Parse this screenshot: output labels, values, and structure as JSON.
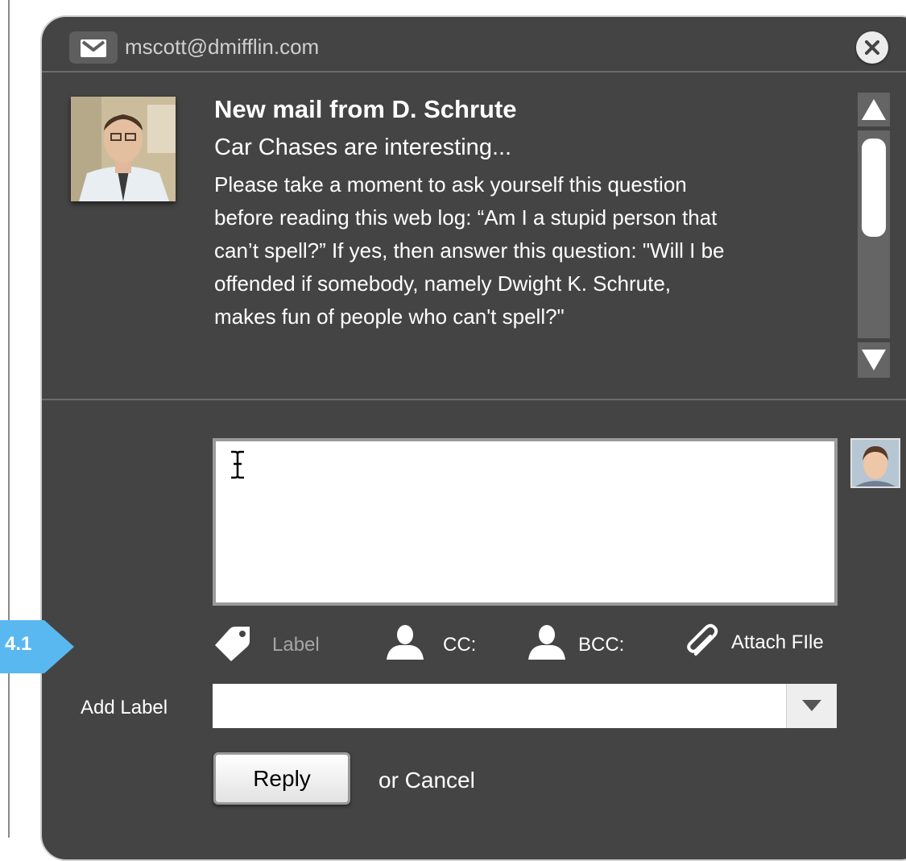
{
  "header": {
    "mail_icon": "envelope-icon",
    "email": "mscott@dmifflin.com",
    "close_icon": "close-icon"
  },
  "message": {
    "title": "New mail from D. Schrute",
    "subject": "Car Chases are interesting...",
    "body_lines": [
      "Please take a moment to ask yourself this question",
      "before reading this web log: “Am I a stupid person that",
      "can’t spell?” If yes, then answer this question: \"Will I be",
      "offended if somebody, namely Dwight K. Schrute,",
      "makes fun of people who can't spell?\""
    ]
  },
  "compose": {
    "text": "",
    "cursor_icon": "text-cursor-icon"
  },
  "callout": {
    "number": "4.1",
    "color": "#5ab8f0"
  },
  "toolbar": {
    "label": "Label",
    "cc": "CC:",
    "bcc": "BCC:",
    "attach": "Attach FIle"
  },
  "add_label": {
    "label": "Add Label",
    "value": ""
  },
  "actions": {
    "reply": "Reply",
    "cancel": "or Cancel"
  },
  "colors": {
    "panel_bg": "#444444",
    "scrollbar": "#656565",
    "text_muted": "#a6a6a6"
  }
}
